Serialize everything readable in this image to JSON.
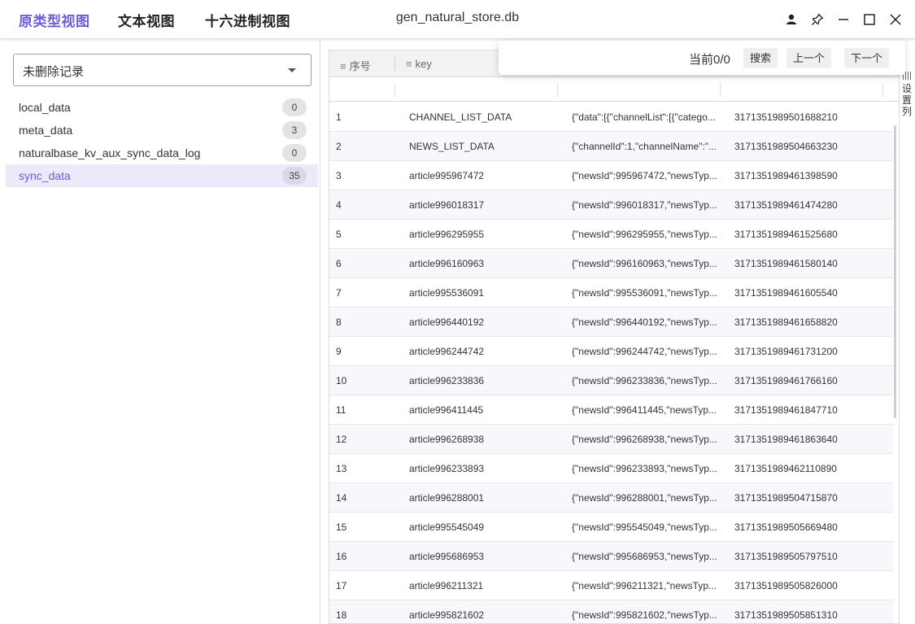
{
  "topbar": {
    "tabs": [
      "原类型视图",
      "文本视图",
      "十六进制视图"
    ],
    "title": "gen_natural_store.db"
  },
  "icons": {
    "user": "user-icon",
    "pin": "pin-icon",
    "minimize": "minimize-icon",
    "maximize": "maximize-icon",
    "close": "close-icon"
  },
  "colors": {
    "accent": "#6f5bd6",
    "selected_bg": "#ece9fb"
  },
  "left": {
    "filter_select": "未删除记录",
    "tables": [
      {
        "name": "local_data",
        "count": "0"
      },
      {
        "name": "meta_data",
        "count": "3"
      },
      {
        "name": "naturalbase_kv_aux_sync_data_log",
        "count": "0"
      },
      {
        "name": "sync_data",
        "count": "35"
      }
    ],
    "selected_table": "sync_data"
  },
  "grid": {
    "columns": [
      "序号",
      "key"
    ],
    "rows": [
      {
        "num": "1",
        "key": "CHANNEL_LIST_DATA",
        "value": "{\"data\":[{\"channelList\":[{\"catego...",
        "ts": "3171351989501688210"
      },
      {
        "num": "2",
        "key": "NEWS_LIST_DATA",
        "value": "{\"channelId\":1,\"channelName\":\"...",
        "ts": "3171351989504663230"
      },
      {
        "num": "3",
        "key": "article995967472",
        "value": "{\"newsId\":995967472,\"newsTyp...",
        "ts": "3171351989461398590"
      },
      {
        "num": "4",
        "key": "article996018317",
        "value": "{\"newsId\":996018317,\"newsTyp...",
        "ts": "3171351989461474280"
      },
      {
        "num": "5",
        "key": "article996295955",
        "value": "{\"newsId\":996295955,\"newsTyp...",
        "ts": "3171351989461525680"
      },
      {
        "num": "6",
        "key": "article996160963",
        "value": "{\"newsId\":996160963,\"newsTyp...",
        "ts": "3171351989461580140"
      },
      {
        "num": "7",
        "key": "article995536091",
        "value": "{\"newsId\":995536091,\"newsTyp...",
        "ts": "3171351989461605540"
      },
      {
        "num": "8",
        "key": "article996440192",
        "value": "{\"newsId\":996440192,\"newsTyp...",
        "ts": "3171351989461658820"
      },
      {
        "num": "9",
        "key": "article996244742",
        "value": "{\"newsId\":996244742,\"newsTyp...",
        "ts": "3171351989461731200"
      },
      {
        "num": "10",
        "key": "article996233836",
        "value": "{\"newsId\":996233836,\"newsTyp...",
        "ts": "3171351989461766160"
      },
      {
        "num": "11",
        "key": "article996411445",
        "value": "{\"newsId\":996411445,\"newsTyp...",
        "ts": "3171351989461847710"
      },
      {
        "num": "12",
        "key": "article996268938",
        "value": "{\"newsId\":996268938,\"newsTyp...",
        "ts": "3171351989461863640"
      },
      {
        "num": "13",
        "key": "article996233893",
        "value": "{\"newsId\":996233893,\"newsTyp...",
        "ts": "3171351989462110890"
      },
      {
        "num": "14",
        "key": "article996288001",
        "value": "{\"newsId\":996288001,\"newsTyp...",
        "ts": "3171351989504715870"
      },
      {
        "num": "15",
        "key": "article995545049",
        "value": "{\"newsId\":995545049,\"newsTyp...",
        "ts": "3171351989505669480"
      },
      {
        "num": "16",
        "key": "article995686953",
        "value": "{\"newsId\":995686953,\"newsTyp...",
        "ts": "3171351989505797510"
      },
      {
        "num": "17",
        "key": "article996211321",
        "value": "{\"newsId\":996211321,\"newsTyp...",
        "ts": "3171351989505826000"
      },
      {
        "num": "18",
        "key": "article995821602",
        "value": "{\"newsId\":995821602,\"newsTyp...",
        "ts": "3171351989505851310"
      }
    ]
  },
  "side_settings": {
    "label": "设置列"
  },
  "search": {
    "status": "当前0/0",
    "search_label": "搜索",
    "prev_label": "上一个",
    "next_label": "下一个"
  }
}
